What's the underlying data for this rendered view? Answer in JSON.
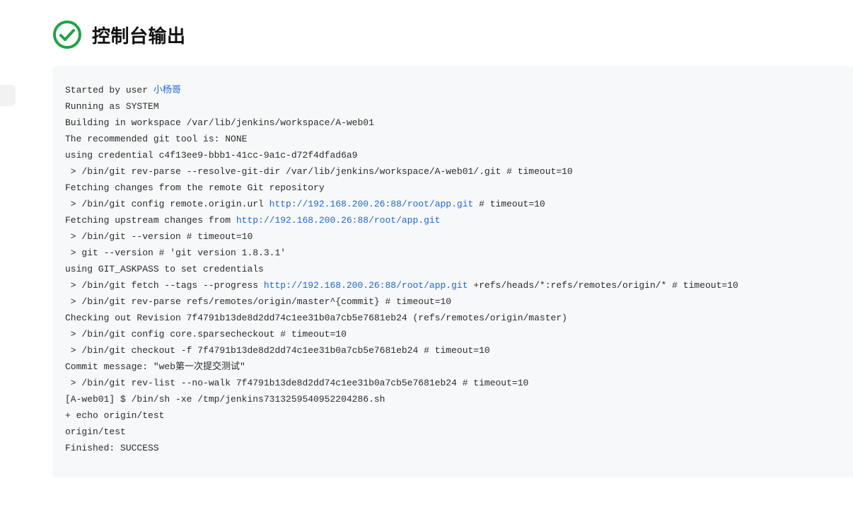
{
  "header": {
    "title": "控制台输出",
    "status_icon_name": "success-checkmark"
  },
  "console": {
    "lines": [
      {
        "segments": [
          {
            "t": "Started by user "
          },
          {
            "t": "小杨哥",
            "link": true
          }
        ]
      },
      {
        "segments": [
          {
            "t": "Running as SYSTEM"
          }
        ]
      },
      {
        "segments": [
          {
            "t": "Building in workspace /var/lib/jenkins/workspace/A-web01"
          }
        ]
      },
      {
        "segments": [
          {
            "t": "The recommended git tool is: NONE"
          }
        ]
      },
      {
        "segments": [
          {
            "t": "using credential c4f13ee9-bbb1-41cc-9a1c-d72f4dfad6a9"
          }
        ]
      },
      {
        "segments": [
          {
            "t": " > /bin/git rev-parse --resolve-git-dir /var/lib/jenkins/workspace/A-web01/.git # timeout=10"
          }
        ]
      },
      {
        "segments": [
          {
            "t": "Fetching changes from the remote Git repository"
          }
        ]
      },
      {
        "segments": [
          {
            "t": " > /bin/git config remote.origin.url "
          },
          {
            "t": "http://192.168.200.26:88/root/app.git",
            "link": true
          },
          {
            "t": " # timeout=10"
          }
        ]
      },
      {
        "segments": [
          {
            "t": "Fetching upstream changes from "
          },
          {
            "t": "http://192.168.200.26:88/root/app.git",
            "link": true
          }
        ]
      },
      {
        "segments": [
          {
            "t": " > /bin/git --version # timeout=10"
          }
        ]
      },
      {
        "segments": [
          {
            "t": " > git --version # 'git version 1.8.3.1'"
          }
        ]
      },
      {
        "segments": [
          {
            "t": "using GIT_ASKPASS to set credentials "
          }
        ]
      },
      {
        "segments": [
          {
            "t": " > /bin/git fetch --tags --progress "
          },
          {
            "t": "http://192.168.200.26:88/root/app.git",
            "link": true
          },
          {
            "t": " +refs/heads/*:refs/remotes/origin/* # timeout=10"
          }
        ]
      },
      {
        "segments": [
          {
            "t": " > /bin/git rev-parse refs/remotes/origin/master^{commit} # timeout=10"
          }
        ]
      },
      {
        "segments": [
          {
            "t": "Checking out Revision 7f4791b13de8d2dd74c1ee31b0a7cb5e7681eb24 (refs/remotes/origin/master)"
          }
        ]
      },
      {
        "segments": [
          {
            "t": " > /bin/git config core.sparsecheckout # timeout=10"
          }
        ]
      },
      {
        "segments": [
          {
            "t": " > /bin/git checkout -f 7f4791b13de8d2dd74c1ee31b0a7cb5e7681eb24 # timeout=10"
          }
        ]
      },
      {
        "segments": [
          {
            "t": "Commit message: \"web第一次提交测试\""
          }
        ]
      },
      {
        "segments": [
          {
            "t": " > /bin/git rev-list --no-walk 7f4791b13de8d2dd74c1ee31b0a7cb5e7681eb24 # timeout=10"
          }
        ]
      },
      {
        "segments": [
          {
            "t": "[A-web01] $ /bin/sh -xe /tmp/jenkins7313259540952204286.sh"
          }
        ]
      },
      {
        "segments": [
          {
            "t": "+ echo origin/test"
          }
        ]
      },
      {
        "segments": [
          {
            "t": "origin/test"
          }
        ]
      },
      {
        "segments": [
          {
            "t": "Finished: SUCCESS"
          }
        ]
      }
    ]
  }
}
